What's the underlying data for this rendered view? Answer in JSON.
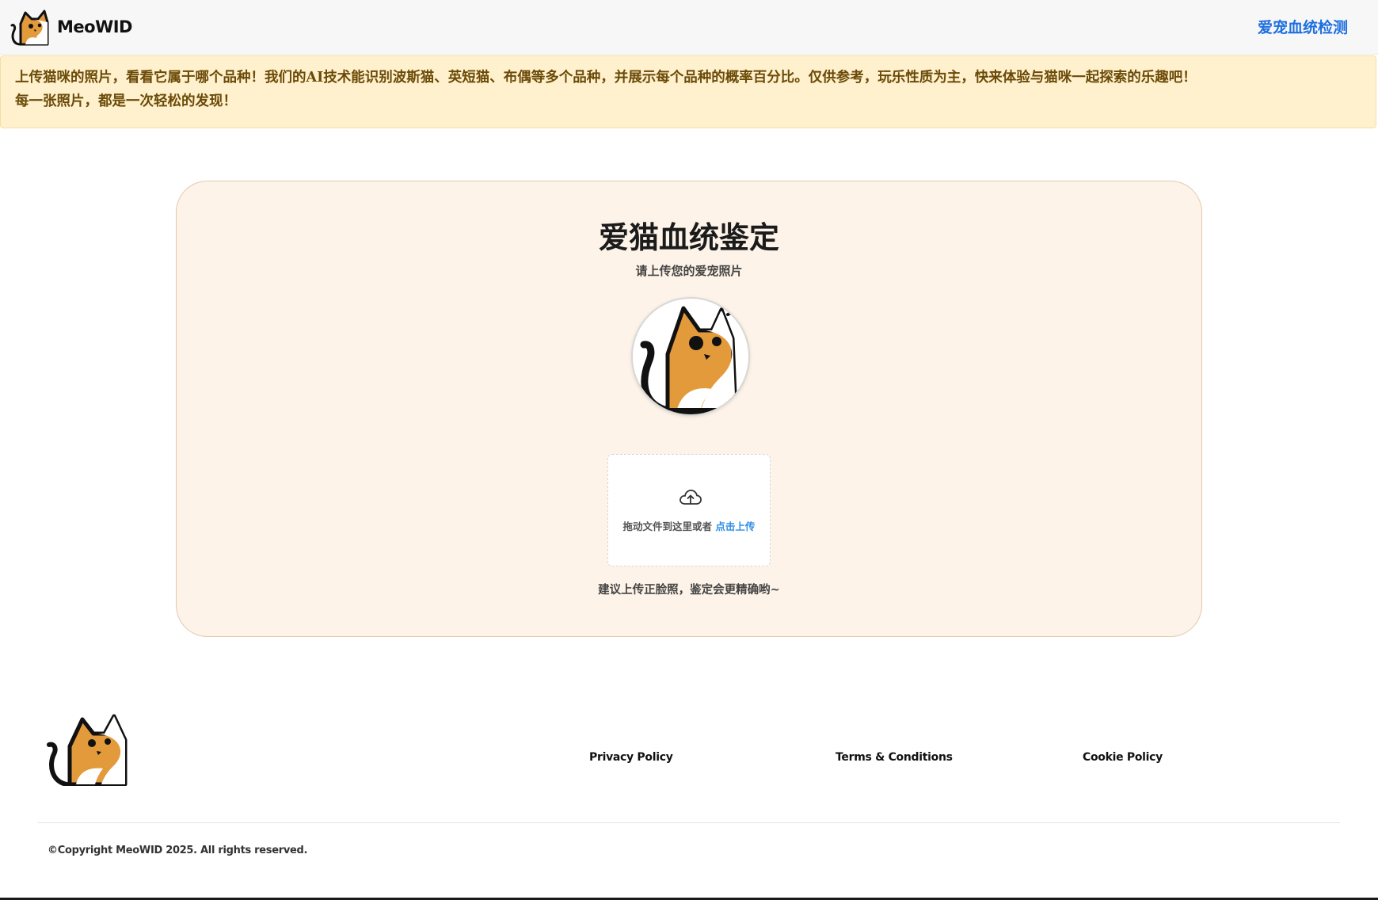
{
  "header": {
    "brand_name": "MeoWID",
    "nav_link": "爱宠血统检测"
  },
  "notice": {
    "line1": "上传猫咪的照片，看看它属于哪个品种！我们的AI技术能识别波斯猫、英短猫、布偶等多个品种，并展示每个品种的概率百分比。仅供参考，玩乐性质为主，快来体验与猫咪一起探索的乐趣吧！",
    "line2": "每一张照片，都是一次轻松的发现！"
  },
  "card": {
    "title": "爱猫血统鉴定",
    "subtitle": "请上传您的爱宠照片",
    "dropzone_text": "拖动文件到这里或者",
    "dropzone_link": "点击上传",
    "hint": "建议上传正脸照，鉴定会更精确哟~"
  },
  "footer": {
    "links": [
      "Privacy Policy",
      "Terms & Conditions",
      "Cookie Policy"
    ],
    "copyright": "©Copyright MeoWID 2025. All rights reserved."
  },
  "colors": {
    "accent_link": "#1e6fe0",
    "notice_bg": "#fff1cd",
    "card_bg": "#fdf3e8",
    "cat_orange": "#e39a3b"
  },
  "icons": [
    "cat-logo-icon",
    "cloud-upload-icon"
  ]
}
